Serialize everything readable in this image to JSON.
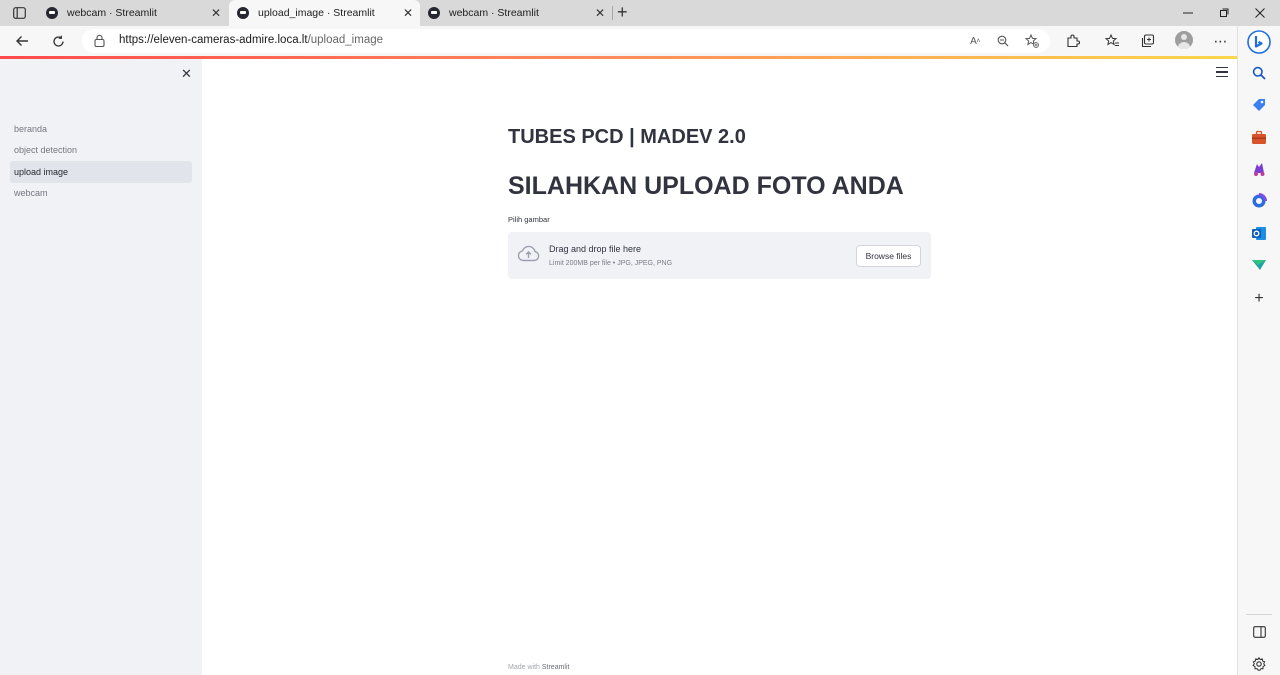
{
  "browser": {
    "tabs": [
      {
        "title": "webcam · Streamlit",
        "active": false
      },
      {
        "title": "upload_image · Streamlit",
        "active": true
      },
      {
        "title": "webcam · Streamlit",
        "active": false
      }
    ],
    "url_host": "https://eleven-cameras-admire.loca.lt",
    "url_path": "/upload_image",
    "icons": {
      "tab_actions": "tab-actions-icon",
      "new_tab": "plus-icon",
      "window_controls": [
        "minimize-icon",
        "maximize-icon",
        "close-icon"
      ],
      "toolbar": [
        "read-aloud-icon",
        "zoom-icon",
        "favorite-add-icon",
        "extensions-icon",
        "favorites-icon",
        "collections-icon",
        "profile-icon",
        "more-icon",
        "bing-icon"
      ],
      "rail": [
        "search-icon",
        "shopping-icon",
        "tools-icon",
        "games-icon",
        "office-icon",
        "outlook-icon",
        "drop-icon",
        "add-icon",
        "sidebar-toggle-icon",
        "settings-icon"
      ]
    }
  },
  "sidebar": {
    "items": [
      {
        "label": "beranda",
        "active": false
      },
      {
        "label": "object detection",
        "active": false
      },
      {
        "label": "upload image",
        "active": true
      },
      {
        "label": "webcam",
        "active": false
      }
    ]
  },
  "main": {
    "subtitle": "TUBES PCD | MADEV 2.0",
    "title": "SILAHKAN UPLOAD FOTO ANDA",
    "uploader": {
      "label": "Pilih gambar",
      "drag_text": "Drag and drop file here",
      "limit_text": "Limit 200MB per file • JPG, JPEG, PNG",
      "browse_label": "Browse files"
    },
    "footer": {
      "made_with": "Made with ",
      "brand": "Streamlit"
    }
  },
  "colors": {
    "sidebar_bg": "#f0f2f6",
    "active_item_bg": "#e1e4eb",
    "text": "#31333f",
    "loading_gradient_start": "#ff4b4b",
    "loading_gradient_end": "#fdd74a"
  }
}
